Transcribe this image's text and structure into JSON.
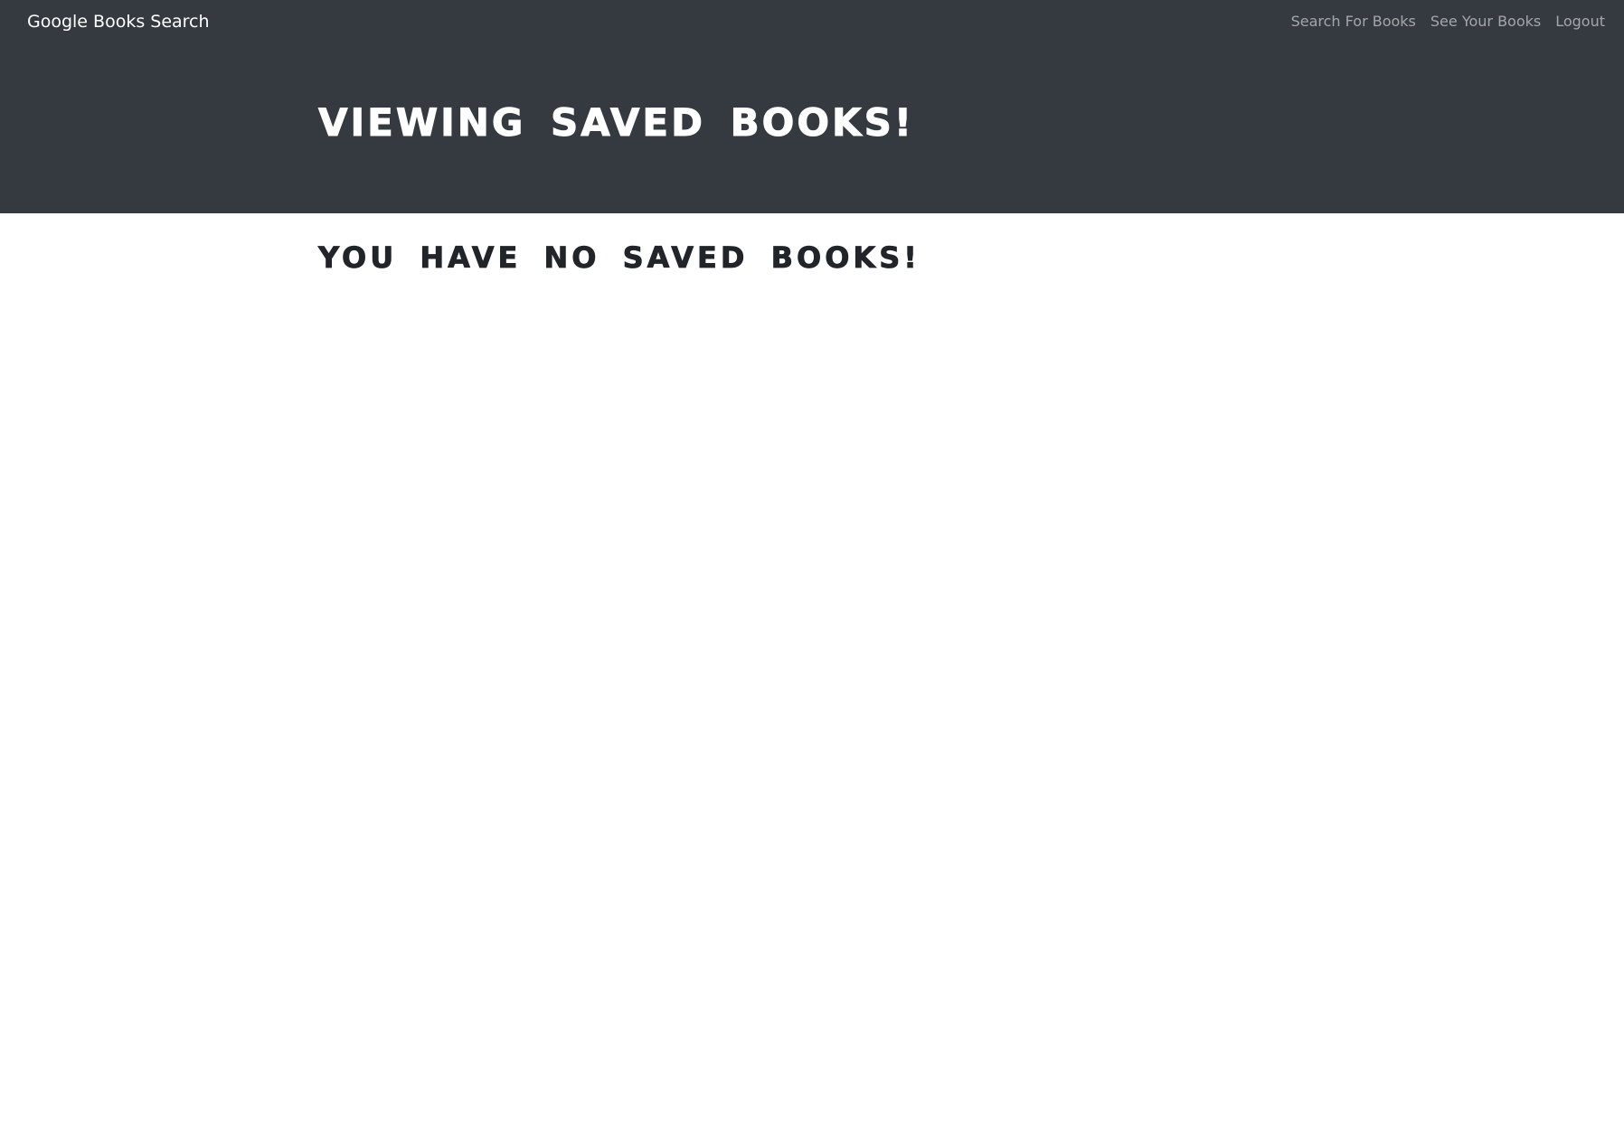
{
  "navbar": {
    "brand": "Google Books Search",
    "links": [
      "Search For Books",
      "See Your Books",
      "Logout"
    ]
  },
  "hero": {
    "title": "Viewing saved books!"
  },
  "main": {
    "empty_message": "You have no saved books!"
  },
  "colors": {
    "navbar_background": "#343a40",
    "text_dark": "#212529",
    "nav_link_muted": "rgba(255,255,255,0.55)"
  }
}
